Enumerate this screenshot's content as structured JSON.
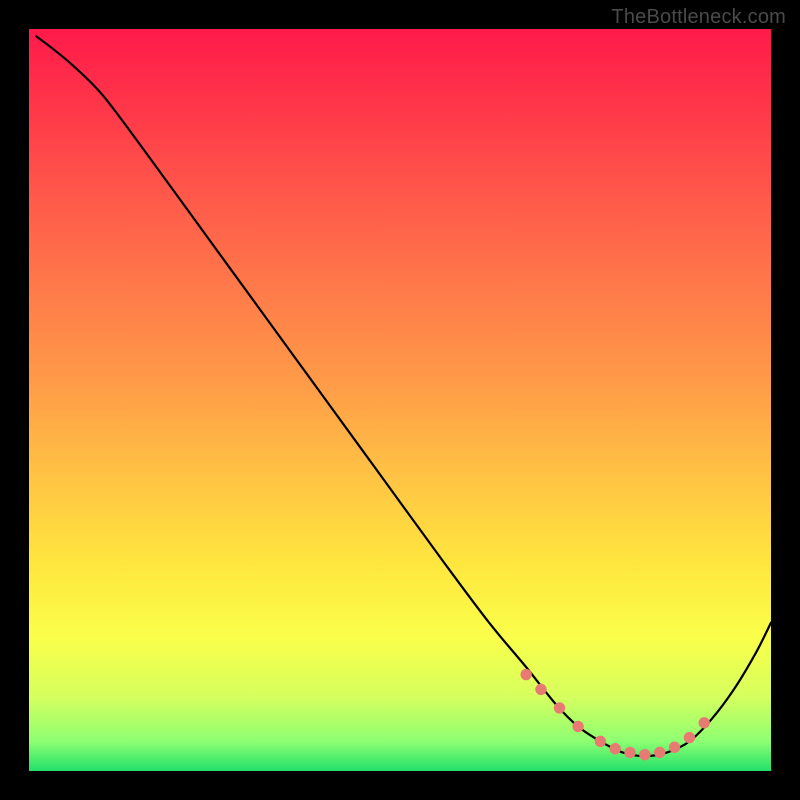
{
  "watermark": "TheBottleneck.com",
  "gradient": {
    "stops": [
      {
        "offset": "0%",
        "color": "#ff1a4b"
      },
      {
        "offset": "10%",
        "color": "#ff3549"
      },
      {
        "offset": "22%",
        "color": "#ff574a"
      },
      {
        "offset": "35%",
        "color": "#ff7a4a"
      },
      {
        "offset": "48%",
        "color": "#ff9c48"
      },
      {
        "offset": "60%",
        "color": "#ffc244"
      },
      {
        "offset": "72%",
        "color": "#ffe63e"
      },
      {
        "offset": "82%",
        "color": "#faff4a"
      },
      {
        "offset": "90%",
        "color": "#d6ff5e"
      },
      {
        "offset": "96%",
        "color": "#8dff72"
      },
      {
        "offset": "100%",
        "color": "#22e06b"
      }
    ]
  },
  "chart_data": {
    "type": "line",
    "title": "",
    "xlabel": "",
    "ylabel": "",
    "xlim": [
      0,
      100
    ],
    "ylim": [
      0,
      100
    ],
    "series": [
      {
        "name": "bottleneck-curve",
        "x": [
          1,
          3,
          6,
          10,
          16,
          24,
          32,
          40,
          48,
          56,
          62,
          67,
          71,
          74,
          77,
          80,
          83,
          86,
          89,
          92,
          95,
          98,
          100
        ],
        "y": [
          99,
          97.5,
          95,
          91,
          83,
          72,
          61,
          50,
          39,
          28,
          20,
          14,
          9,
          6,
          4,
          2.5,
          2,
          2.5,
          4,
          7,
          11,
          16,
          20
        ]
      }
    ],
    "data_points": {
      "name": "highlighted-samples",
      "x": [
        67,
        69,
        71.5,
        74,
        77,
        79,
        81,
        83,
        85,
        87,
        89,
        91
      ],
      "y": [
        13,
        11,
        8.5,
        6,
        4,
        3,
        2.5,
        2.2,
        2.5,
        3.2,
        4.5,
        6.5
      ]
    }
  }
}
